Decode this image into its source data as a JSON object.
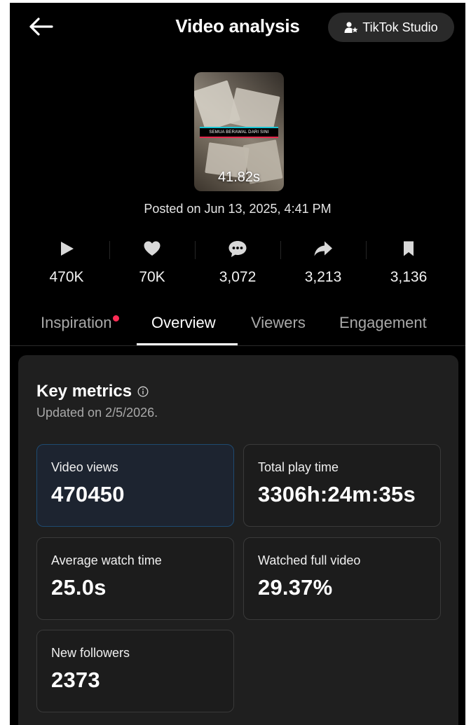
{
  "header": {
    "title": "Video analysis",
    "studio_label": "TikTok Studio"
  },
  "video": {
    "thumbnail_caption": "SEMUA BERAWAL DARI SINI",
    "duration": "41.82s",
    "posted": "Posted on Jun 13, 2025, 4:41 PM"
  },
  "stats": [
    {
      "icon": "play-icon",
      "value": "470K"
    },
    {
      "icon": "heart-icon",
      "value": "70K"
    },
    {
      "icon": "comment-icon",
      "value": "3,072"
    },
    {
      "icon": "share-icon",
      "value": "3,213"
    },
    {
      "icon": "bookmark-icon",
      "value": "3,136"
    }
  ],
  "tabs": [
    {
      "label": "Inspiration",
      "has_dot": true
    },
    {
      "label": "Overview",
      "active": true
    },
    {
      "label": "Viewers"
    },
    {
      "label": "Engagement"
    }
  ],
  "key_metrics": {
    "title": "Key metrics",
    "updated": "Updated on 2/5/2026.",
    "items": [
      {
        "label": "Video views",
        "value": "470450"
      },
      {
        "label": "Total play time",
        "value": "3306h:24m:35s"
      },
      {
        "label": "Average watch time",
        "value": "25.0s"
      },
      {
        "label": "Watched full video",
        "value": "29.37%"
      },
      {
        "label": "New followers",
        "value": "2373"
      }
    ]
  },
  "colors": {
    "background": "#000000",
    "card": "#1f1f1f",
    "accent_dot": "#fe2c55",
    "selected_border": "#1e4a70"
  }
}
